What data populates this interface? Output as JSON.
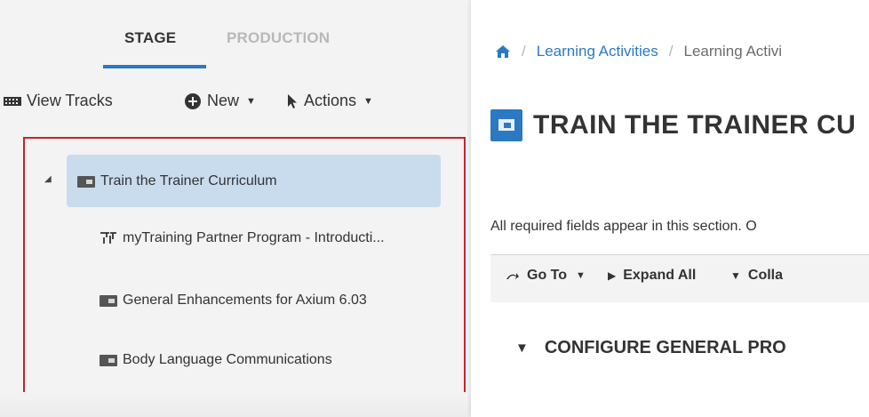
{
  "tabs": [
    {
      "label": "STAGE",
      "active": true
    },
    {
      "label": "PRODUCTION",
      "active": false
    }
  ],
  "toolbar": {
    "view_tracks": "View Tracks",
    "new": "New",
    "actions": "Actions"
  },
  "tree": {
    "root": {
      "label": "Train the Trainer Curriculum",
      "icon": "course-icon",
      "selected": true,
      "expanded": true
    },
    "children": [
      {
        "label": "myTraining Partner Program - Introducti...",
        "icon": "track-icon"
      },
      {
        "label": "General Enhancements for Axium 6.03",
        "icon": "course-icon"
      },
      {
        "label": "Body Language Communications",
        "icon": "course-icon"
      }
    ]
  },
  "breadcrumb": {
    "items": [
      "Learning Activities",
      "Learning Activi"
    ]
  },
  "page": {
    "title": "TRAIN THE TRAINER CU",
    "description": "All required fields appear in this section. O"
  },
  "action_bar": {
    "goto": "Go To",
    "expand_all": "Expand All",
    "collapse": "Colla"
  },
  "section": {
    "title": "CONFIGURE GENERAL PRO"
  },
  "colors": {
    "accent": "#2b79c2",
    "selected_row": "#c9dcee",
    "highlight_border": "#c0262a",
    "inactive_tab": "#b8b8b8"
  }
}
